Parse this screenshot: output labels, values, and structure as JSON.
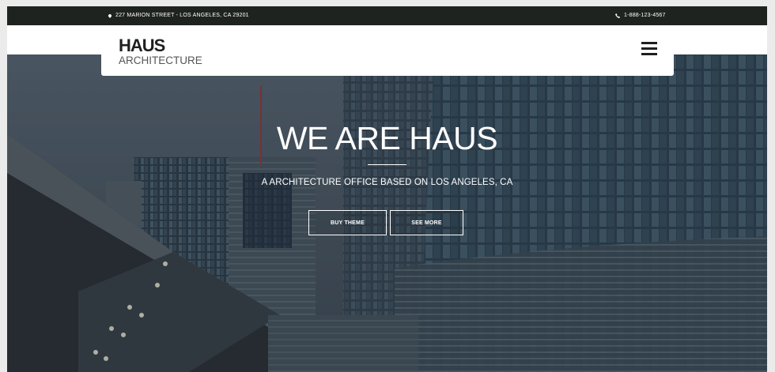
{
  "topbar": {
    "address": "227 MARION STREET - LOS ANGELES, CA 29201",
    "address_icon": "map-pin-icon",
    "phone": "1-888-123-4567",
    "phone_icon": "phone-icon"
  },
  "header": {
    "logo_title": "HAUS",
    "logo_subtitle": "ARCHITECTURE",
    "menu_icon": "hamburger-menu-icon"
  },
  "hero": {
    "title": "WE ARE HAUS",
    "subtitle": "A ARCHITECTURE OFFICE BASED ON LOS ANGELES, CA",
    "buttons": [
      {
        "label": "BUY THEME"
      },
      {
        "label": "SEE MORE"
      }
    ]
  },
  "colors": {
    "topbar_bg": "#1f231f",
    "header_bg": "#ffffff",
    "text_light": "#ffffff",
    "logo_dark": "#1f1f1f"
  }
}
